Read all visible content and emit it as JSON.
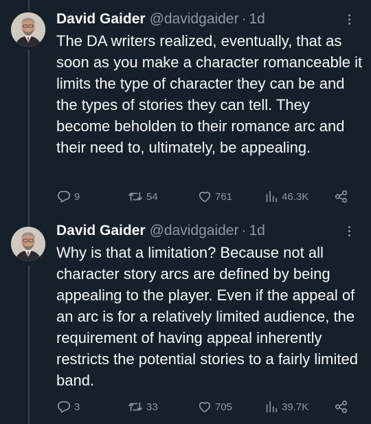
{
  "tweets": [
    {
      "author": {
        "name": "David Gaider",
        "handle": "@davidgaider",
        "separator": "·",
        "time": "1d"
      },
      "text": "The DA writers realized, eventually, that as soon as you make a character romanceable it limits the type of character they can be and the types of stories they can tell. They become beholden to their romance arc and their need to, ultimately, be appealing.",
      "stats": {
        "replies": "9",
        "retweets": "54",
        "likes": "761",
        "views": "46.3K"
      }
    },
    {
      "author": {
        "name": "David Gaider",
        "handle": "@davidgaider",
        "separator": "·",
        "time": "1d"
      },
      "text": "Why is that a limitation? Because not all character story arcs are defined by being appealing to the player. Even if the appeal of an arc is for a relatively limited audience, the requirement of having appeal inherently restricts the potential stories to a fairly limited band.",
      "stats": {
        "replies": "3",
        "retweets": "33",
        "likes": "705",
        "views": "39.7K"
      }
    }
  ],
  "icons": {
    "reply": "speech-bubble-icon",
    "retweet": "retweet-arrows-icon",
    "like": "heart-icon",
    "views": "bar-chart-icon",
    "share": "share-nodes-icon",
    "more": "more-dots-icon"
  },
  "colors": {
    "background": "#15202b",
    "text": "#f7f9f9",
    "muted": "#8b98a5",
    "thread_line": "#38444d"
  }
}
